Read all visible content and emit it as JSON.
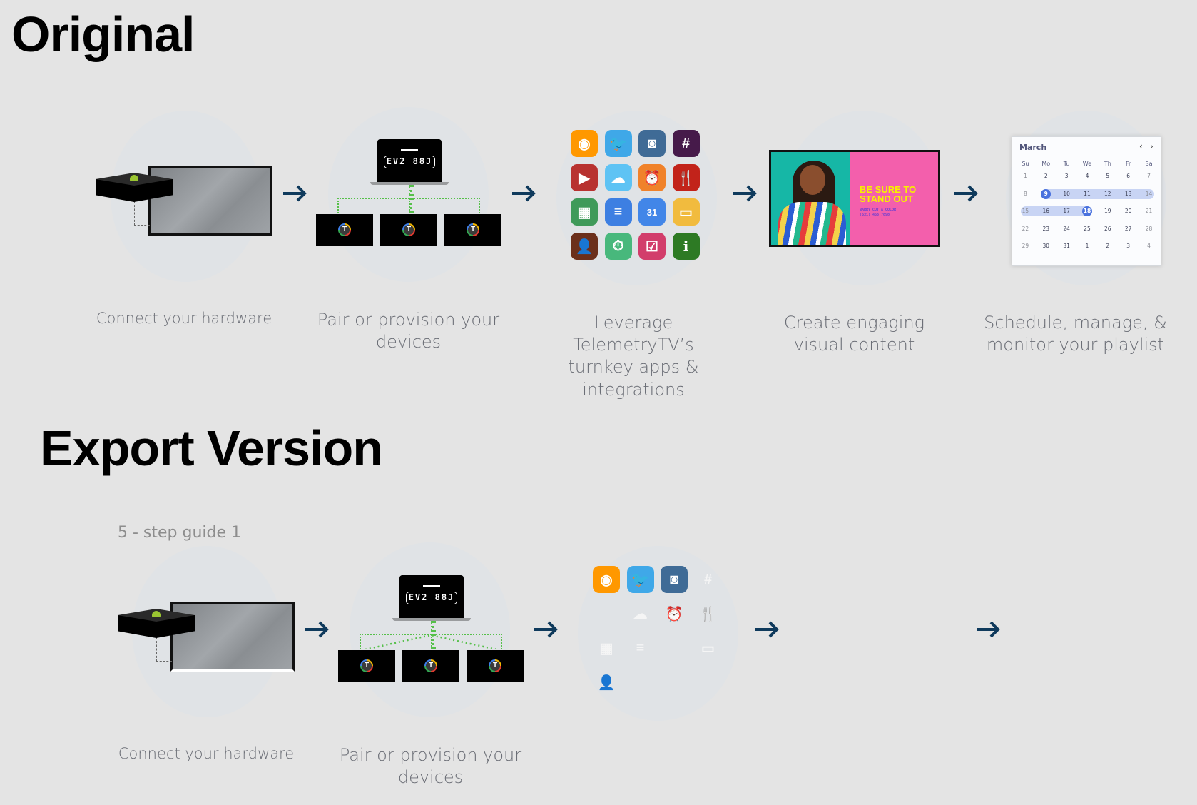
{
  "sections": {
    "original_title": "Original",
    "export_title": "Export Version",
    "export_guide_label": "5 - step guide 1"
  },
  "colors": {
    "background": "#e4e4e4",
    "arrow": "#0f3a5c",
    "caption": "#6b6e76",
    "pairing_dots": "#56c04a",
    "calendar_selected": "#4a72de",
    "calendar_range": "#c8d4f4"
  },
  "steps": [
    {
      "id": "hardware",
      "caption": "Connect your hardware"
    },
    {
      "id": "pair",
      "caption": "Pair or provision your devices",
      "device_code": "EV2 88J",
      "device_logo": "T"
    },
    {
      "id": "apps",
      "caption": "Leverage TelemetryTV’s turnkey apps & integrations"
    },
    {
      "id": "content",
      "caption": "Create engaging visual content",
      "headline": "BE SURE TO STAND OUT",
      "business": "BARRY CUT & COLOR",
      "phone": "(531) 456 7898"
    },
    {
      "id": "schedule",
      "caption": "Schedule, manage, & monitor your playlist"
    }
  ],
  "apps": [
    {
      "name": "rss-icon",
      "glyph": "◉",
      "color": "#ff9800"
    },
    {
      "name": "twitter-icon",
      "glyph": "🐦",
      "color": "#3fa8e8"
    },
    {
      "name": "instagram-icon",
      "glyph": "◙",
      "color": "#3f6b96"
    },
    {
      "name": "slack-icon",
      "glyph": "#",
      "color": "#461a4a"
    },
    {
      "name": "youtube-icon",
      "glyph": "▶",
      "color": "#b83230"
    },
    {
      "name": "weather-icon",
      "glyph": "☁",
      "color": "#5ec3f4"
    },
    {
      "name": "alarm-icon",
      "glyph": "⏰",
      "color": "#f0822a"
    },
    {
      "name": "restaurant-icon",
      "glyph": "🍴",
      "color": "#c2231a"
    },
    {
      "name": "sheets-icon",
      "glyph": "▦",
      "color": "#3f9a5a"
    },
    {
      "name": "docs-icon",
      "glyph": "≡",
      "color": "#3d7fe2"
    },
    {
      "name": "calendar-icon",
      "glyph": "31",
      "color": "#4286e8"
    },
    {
      "name": "slides-icon",
      "glyph": "▭",
      "color": "#f1bb3e"
    },
    {
      "name": "person-icon",
      "glyph": "👤",
      "color": "#6b2f1b"
    },
    {
      "name": "timer-icon",
      "glyph": "⏱",
      "color": "#48b87c"
    },
    {
      "name": "event-icon",
      "glyph": "☑",
      "color": "#d23d6b"
    },
    {
      "name": "info-icon",
      "glyph": "i",
      "color": "#2d7a24"
    }
  ],
  "export_apps_visible_bg": [
    true,
    true,
    true,
    false,
    false,
    false,
    false,
    false,
    false,
    false,
    false,
    false,
    false,
    false,
    false,
    false
  ],
  "export_apps_visible_glyph": [
    true,
    true,
    true,
    true,
    false,
    true,
    true,
    true,
    true,
    true,
    false,
    true,
    true,
    false,
    false,
    false
  ],
  "calendar": {
    "month": "March",
    "prev": "‹",
    "next": "›",
    "weekdays": [
      "Su",
      "Mo",
      "Tu",
      "We",
      "Th",
      "Fr",
      "Sa"
    ],
    "weeks": [
      [
        "1",
        "2",
        "3",
        "4",
        "5",
        "6",
        "7"
      ],
      [
        "8",
        "9",
        "10",
        "11",
        "12",
        "13",
        "14"
      ],
      [
        "15",
        "16",
        "17",
        "18",
        "19",
        "20",
        "21"
      ],
      [
        "22",
        "23",
        "24",
        "25",
        "26",
        "27",
        "28"
      ],
      [
        "29",
        "30",
        "31",
        "1",
        "2",
        "3",
        "4"
      ]
    ],
    "range_start": "9",
    "range_end": "18"
  }
}
